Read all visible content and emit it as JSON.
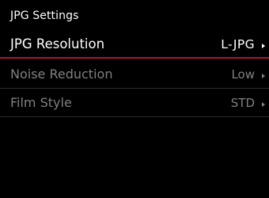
{
  "header": {
    "title": "JPG Settings"
  },
  "menu": {
    "items": [
      {
        "label": "JPG Resolution",
        "value": "L-JPG",
        "state": "selected"
      },
      {
        "label": "Noise Reduction",
        "value": "Low",
        "state": "normal"
      },
      {
        "label": "Film Style",
        "value": "STD",
        "state": "normal"
      }
    ]
  },
  "colors": {
    "background": "#000000",
    "selected_text": "#ffffff",
    "dim_text": "#808080",
    "selection_underline": "#b3122a"
  },
  "icons": {
    "row_arrow": "triangle-right-icon"
  }
}
